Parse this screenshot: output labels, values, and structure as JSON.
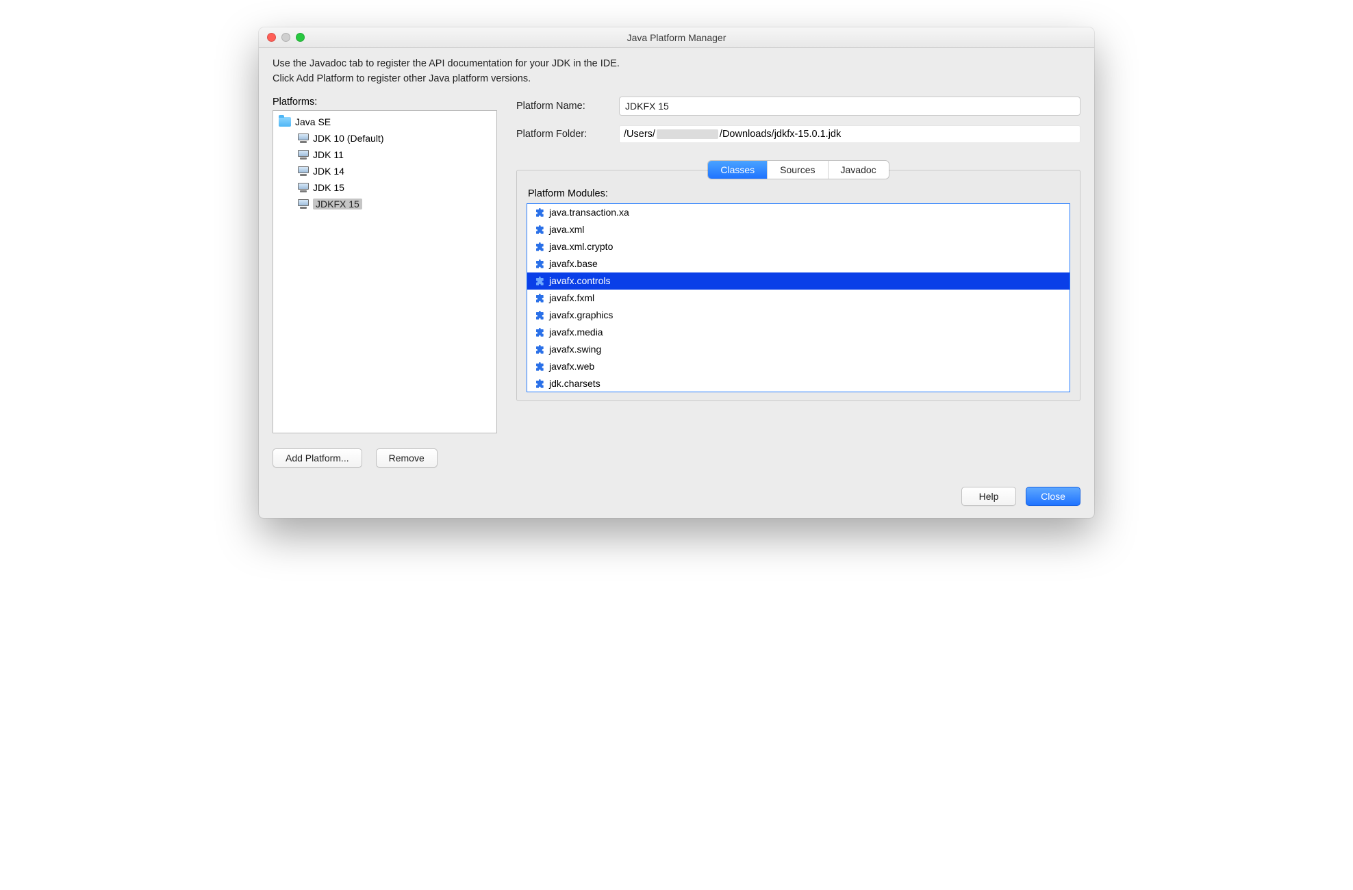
{
  "window": {
    "title": "Java Platform Manager"
  },
  "intro": {
    "line1": "Use the Javadoc tab to register the API documentation for your JDK in the IDE.",
    "line2": "Click Add Platform to register other Java platform versions."
  },
  "left": {
    "heading": "Platforms:",
    "group": "Java SE",
    "items": [
      {
        "label": "JDK 10 (Default)",
        "selected": false
      },
      {
        "label": "JDK 11",
        "selected": false
      },
      {
        "label": "JDK 14",
        "selected": false
      },
      {
        "label": "JDK 15",
        "selected": false
      },
      {
        "label": "JDKFX 15",
        "selected": true
      }
    ]
  },
  "right": {
    "name_label": "Platform Name:",
    "name_value": "JDKFX 15",
    "folder_label": "Platform Folder:",
    "folder_parts": {
      "prefix": "/Users/",
      "redacted": true,
      "suffix": "/Downloads/jdkfx-15.0.1.jdk"
    },
    "tabs": [
      {
        "label": "Classes",
        "active": true
      },
      {
        "label": "Sources",
        "active": false
      },
      {
        "label": "Javadoc",
        "active": false
      }
    ],
    "modules_label": "Platform Modules:",
    "modules": [
      {
        "name": "java.transaction.xa",
        "selected": false
      },
      {
        "name": "java.xml",
        "selected": false
      },
      {
        "name": "java.xml.crypto",
        "selected": false
      },
      {
        "name": "javafx.base",
        "selected": false
      },
      {
        "name": "javafx.controls",
        "selected": true
      },
      {
        "name": "javafx.fxml",
        "selected": false
      },
      {
        "name": "javafx.graphics",
        "selected": false
      },
      {
        "name": "javafx.media",
        "selected": false
      },
      {
        "name": "javafx.swing",
        "selected": false
      },
      {
        "name": "javafx.web",
        "selected": false
      },
      {
        "name": "jdk.charsets",
        "selected": false
      }
    ]
  },
  "buttons": {
    "add_platform": "Add Platform...",
    "remove": "Remove",
    "help": "Help",
    "close": "Close"
  }
}
